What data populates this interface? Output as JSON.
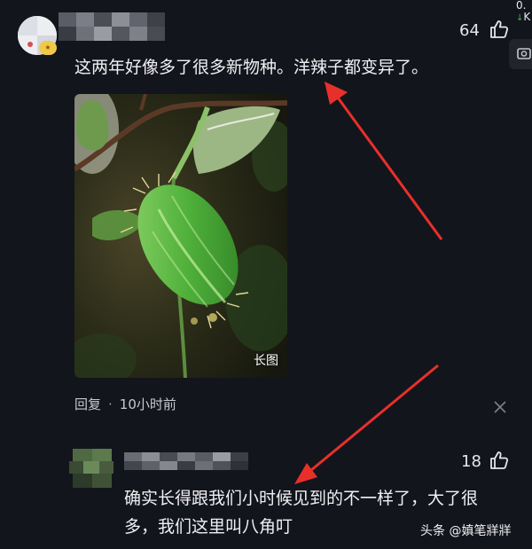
{
  "comments": [
    {
      "like_count": "64",
      "text": "这两年好像多了很多新物种。洋辣子都变异了。",
      "image": {
        "tag": "长图"
      },
      "meta": {
        "reply_label": "回复",
        "separator": "·",
        "time": "10小时前"
      }
    },
    {
      "like_count": "18",
      "text_line1": "确实长得跟我们小时候见到的不一样了，大了很",
      "text_line2": "多，我们这里叫八角叮"
    }
  ],
  "status": {
    "top_value": "0.",
    "top_unit": "K"
  },
  "watermark": "头条 @嫃笔牂牂",
  "colors": {
    "background": "#13151c",
    "arrow": "#e8302a",
    "text": "#f0f0f3"
  }
}
